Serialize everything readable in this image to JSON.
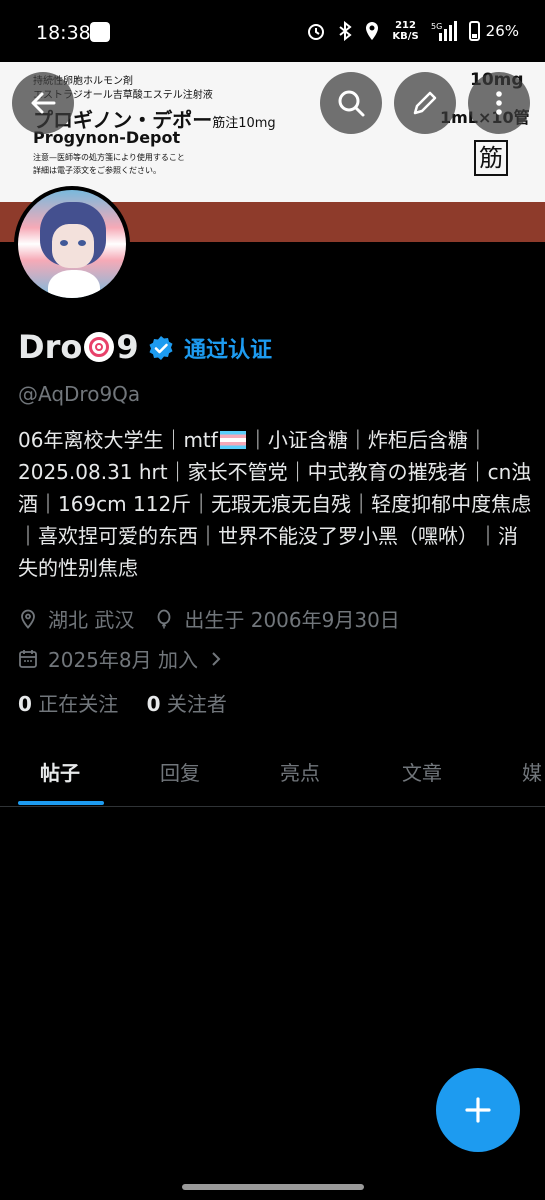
{
  "status_bar": {
    "time": "18:38",
    "speed_value": "212",
    "speed_unit": "KB/S",
    "network": "5G",
    "battery": "26%"
  },
  "banner": {
    "line1": "持続性卵胞ホルモン剤",
    "line2": "エストラジオール吉草酸エステル注射液",
    "product_jp": "プロギノン・デポー",
    "product_jp_suffix": "筋注10mg",
    "product_en": "Progynon-Depot",
    "caution1": "注意—医師等の処方箋により使用すること",
    "caution2": "詳細は電子添文をご参照ください。",
    "dose": "10mg",
    "pack": "1mL×10管",
    "route": "筋"
  },
  "profile": {
    "name_part1": "Dro",
    "name_part2": "9",
    "verified_label": "通过认证",
    "handle": "@AqDro9Qa",
    "bio_part1": "06年离校大学生｜mtf",
    "bio_part2": "｜小证含糖｜炸柜后含糖｜2025.08.31 hrt｜家长不管党｜中式教育の摧残者｜cn浊酒｜169cm 112斤｜无瑕无痕无自残｜轻度抑郁中度焦虑｜喜欢捏可爱的东西｜世界不能没了罗小黑（嘿咻）｜消失的性别焦虑",
    "location": "湖北 武汉",
    "birthday": "出生于 2006年9月30日",
    "joined": "2025年8月 加入",
    "following_count": "0",
    "following_label": "正在关注",
    "followers_count": "0",
    "followers_label": "关注者"
  },
  "tabs": [
    {
      "label": "帖子"
    },
    {
      "label": "回复"
    },
    {
      "label": "亮点"
    },
    {
      "label": "文章"
    },
    {
      "label": "媒"
    }
  ],
  "icons": {
    "back": "arrow-left-icon",
    "search": "search-icon",
    "edit": "edit-icon",
    "more": "more-vertical-icon",
    "compose": "plus-icon"
  },
  "colors": {
    "accent": "#1d9bf0",
    "background": "#000000",
    "secondary_text": "#71767b"
  }
}
